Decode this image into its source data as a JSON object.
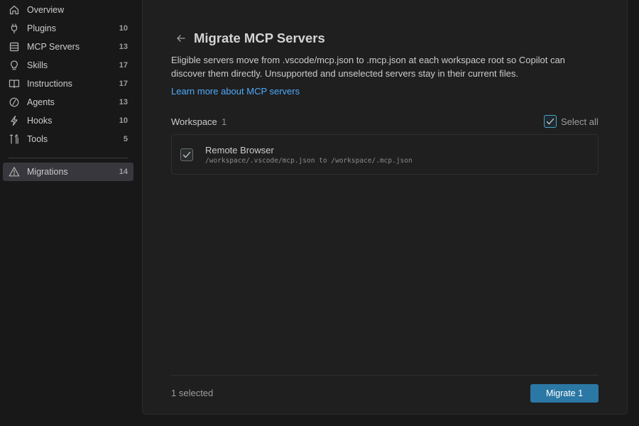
{
  "sidebar": {
    "items": [
      {
        "label": "Overview",
        "count": "",
        "icon": "home-icon"
      },
      {
        "label": "Plugins",
        "count": "10",
        "icon": "plug-icon"
      },
      {
        "label": "MCP Servers",
        "count": "13",
        "icon": "server-icon"
      },
      {
        "label": "Skills",
        "count": "17",
        "icon": "lightbulb-icon"
      },
      {
        "label": "Instructions",
        "count": "17",
        "icon": "book-icon"
      },
      {
        "label": "Agents",
        "count": "13",
        "icon": "agent-icon"
      },
      {
        "label": "Hooks",
        "count": "10",
        "icon": "lightning-icon"
      },
      {
        "label": "Tools",
        "count": "5",
        "icon": "tools-icon"
      }
    ],
    "active_item": {
      "label": "Migrations",
      "count": "14",
      "icon": "warning-icon"
    }
  },
  "main": {
    "title": "Migrate MCP Servers",
    "description": "Eligible servers move from .vscode/mcp.json to .mcp.json at each workspace root so Copilot can discover them directly. Unsupported and unselected servers stay in their current files.",
    "learn_more": "Learn more about MCP servers",
    "section": {
      "label": "Workspace",
      "count": "1"
    },
    "select_all": {
      "label": "Select all",
      "checked": true
    },
    "servers": [
      {
        "name": "Remote Browser",
        "path": "/workspace/.vscode/mcp.json to /workspace/.mcp.json",
        "checked": true
      }
    ],
    "footer": {
      "selected_text": "1 selected",
      "migrate_button": "Migrate 1"
    }
  },
  "colors": {
    "accent": "#2b77a5",
    "link": "#4daafc",
    "background": "#181818",
    "panel": "#1f1f1f"
  }
}
